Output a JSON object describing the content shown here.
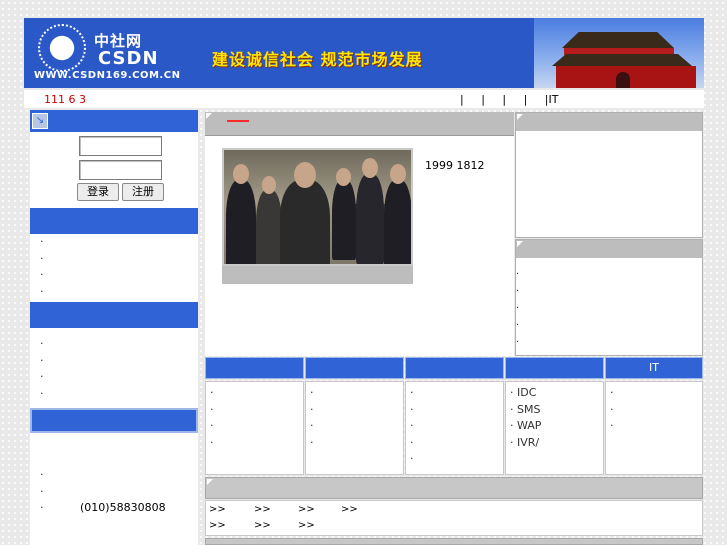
{
  "header": {
    "logo_cn": "中社网",
    "logo_en": "CSDN",
    "logo_url": "WWW.CSDN169.COM.CN",
    "slogan": "建设诚信社会  规范市场发展",
    "colors": {
      "banner_blue": "#2a58c6",
      "slogan_yellow": "#ffe600"
    }
  },
  "nav": {
    "left_text": "111 6 3",
    "right_text": "|     |     |     |     |IT"
  },
  "login": {
    "arrow_icon": "arrow-icon",
    "username_value": "",
    "password_value": "",
    "login_label": "登录",
    "register_label": "注册"
  },
  "sidebar": {
    "list1": [
      "·",
      "·",
      "·",
      "·"
    ],
    "list2": [
      "·",
      "·",
      "·",
      "·"
    ],
    "list3": [
      "·",
      "·"
    ],
    "phone_bullet": "·",
    "phone": "(010)58830808",
    "accent_color": "#2f63d6"
  },
  "feature": {
    "caption_text": "1999 1812"
  },
  "right_panels": {
    "panel2_dots": [
      "·",
      "·",
      "·",
      "·",
      "·"
    ]
  },
  "columns": [
    {
      "title": "",
      "items": [
        "·",
        "·",
        "·",
        "·"
      ]
    },
    {
      "title": "",
      "items": [
        "·",
        "·",
        "·",
        "·"
      ]
    },
    {
      "title": "",
      "items": [
        "·",
        "·",
        "·",
        "·",
        "·"
      ]
    },
    {
      "title": "",
      "items": [
        "· IDC",
        "· SMS",
        "· WAP",
        "· IVR/"
      ]
    },
    {
      "title": "IT",
      "items": [
        "·",
        "·",
        "·"
      ]
    }
  ],
  "bottom_links": {
    "row1": [
      ">>",
      ">>",
      ">>",
      ">>"
    ],
    "row2": [
      ">>",
      ">>",
      ">>"
    ]
  }
}
